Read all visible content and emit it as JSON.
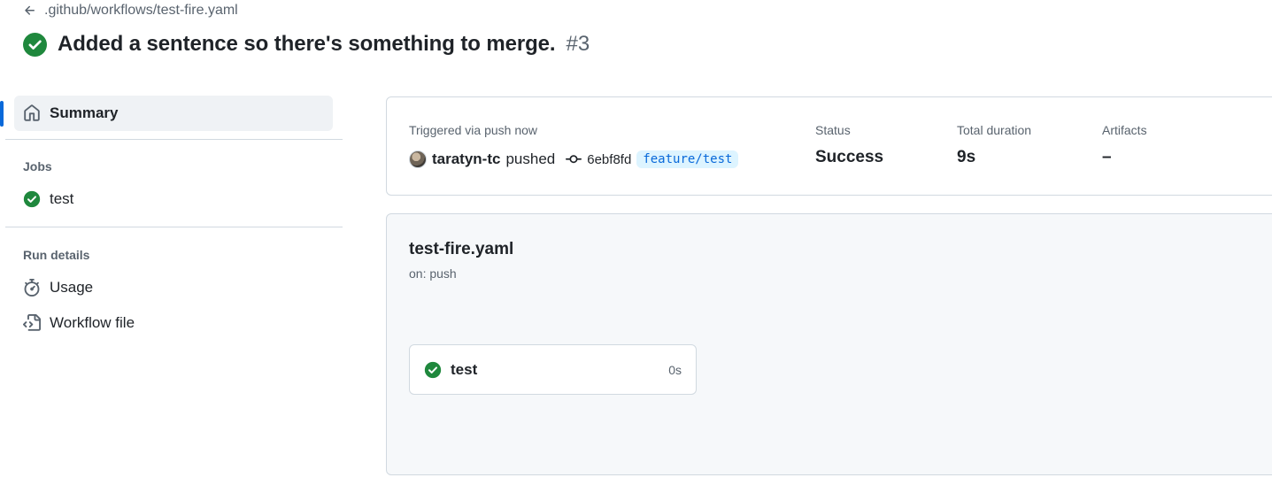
{
  "header": {
    "back_path": ".github/workflows/test-fire.yaml",
    "run_title": "Added a sentence so there's something to merge.",
    "run_number": "#3"
  },
  "sidebar": {
    "summary_label": "Summary",
    "jobs_heading": "Jobs",
    "jobs": [
      {
        "label": "test",
        "status": "success"
      }
    ],
    "run_details_heading": "Run details",
    "run_details": [
      {
        "label": "Usage",
        "icon": "stopwatch-icon"
      },
      {
        "label": "Workflow file",
        "icon": "file-code-icon"
      }
    ]
  },
  "summary": {
    "trigger_label": "Triggered via push now",
    "actor": "taratyn-tc",
    "action": "pushed",
    "commit_sha": "6ebf8fd",
    "branch": "feature/test",
    "status_label": "Status",
    "status_value": "Success",
    "duration_label": "Total duration",
    "duration_value": "9s",
    "artifacts_label": "Artifacts",
    "artifacts_value": "–"
  },
  "workflow_graph": {
    "file_name": "test-fire.yaml",
    "trigger": "on: push",
    "jobs": [
      {
        "name": "test",
        "duration": "0s",
        "status": "success"
      }
    ]
  },
  "colors": {
    "success": "#1f883d",
    "accent": "#0969da",
    "muted_text": "#59636e",
    "border": "#d1d9e0",
    "canvas_subtle": "#f6f8fa"
  }
}
